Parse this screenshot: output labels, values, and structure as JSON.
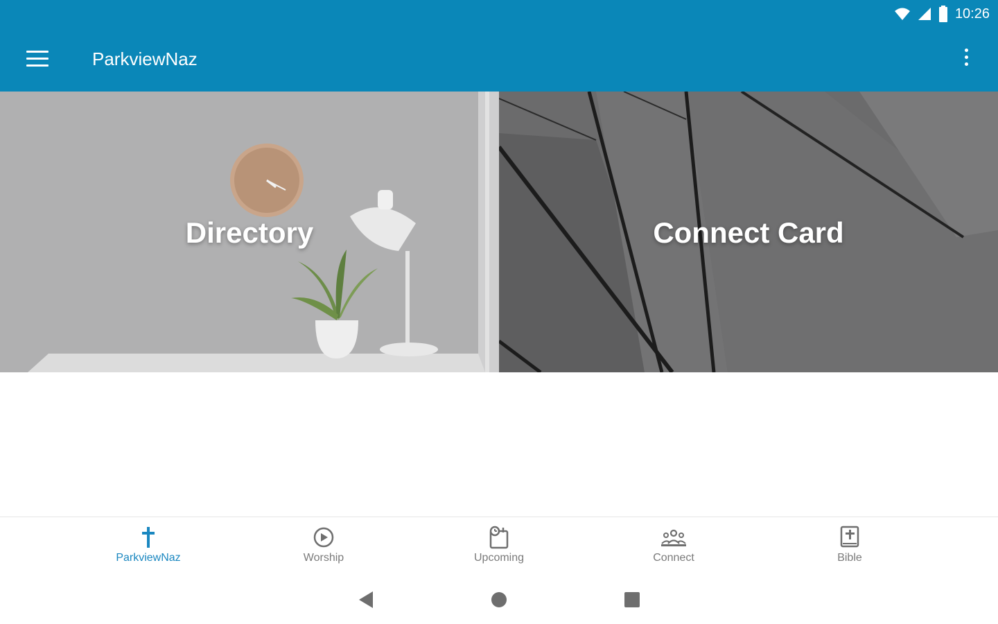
{
  "status_bar": {
    "time": "10:26"
  },
  "app_bar": {
    "title": "ParkviewNaz",
    "menu_icon": "hamburger-menu-icon",
    "overflow_icon": "more-vert-icon"
  },
  "tiles": [
    {
      "label": "Directory"
    },
    {
      "label": "Connect Card"
    }
  ],
  "bottom_nav": {
    "active_color": "#1a87c0",
    "items": [
      {
        "label": "ParkviewNaz",
        "icon": "cross-icon",
        "active": true
      },
      {
        "label": "Worship",
        "icon": "play-circle-icon",
        "active": false
      },
      {
        "label": "Upcoming",
        "icon": "calendar-clock-icon",
        "active": false
      },
      {
        "label": "Connect",
        "icon": "group-icon",
        "active": false
      },
      {
        "label": "Bible",
        "icon": "book-cross-icon",
        "active": false
      }
    ]
  },
  "colors": {
    "app_bar": "#0a87b8",
    "inactive_nav": "#7a7a7a"
  }
}
